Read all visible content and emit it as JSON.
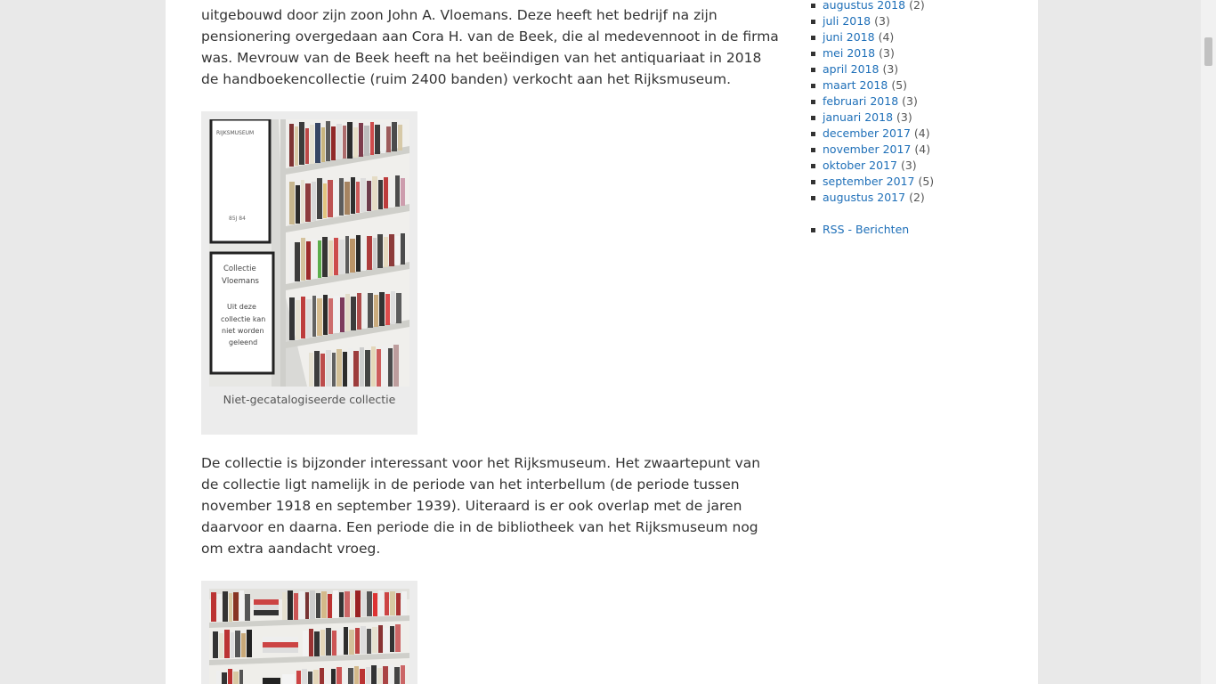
{
  "article": {
    "para1": [
      "uitgebouwd door zijn zoon John A. Vloemans. Deze heeft het bedrijf na zijn",
      "pensionering overgedaan aan Cora H. van de Beek, die al medevennoot in de firma",
      "was. Mevrouw van de Beek heeft na het beëindigen van het antiquariaat in 2018",
      "de handboekencollectie (ruim 2400 banden) verkocht aan het Rijksmuseum."
    ],
    "figure1": {
      "caption": "Niet-gecatalogiseerde collectie",
      "sign_top_title": "RIJKSMUSEUM",
      "sign_top_code": "85J 84",
      "sign_lines": [
        "Collectie",
        "Vloemans",
        "Uit deze",
        "collectie kan",
        "niet worden",
        "geleend"
      ]
    },
    "para2": [
      "De collectie is bijzonder interessant voor het Rijksmuseum. Het zwaartepunt van",
      "de collectie ligt namelijk in de periode van het interbellum (de periode tussen",
      "november 1918 en september 1939). Uiteraard is er ook overlap met de jaren",
      "daarvoor en daarna. Een periode die in de bibliotheek van het Rijksmuseum nog",
      "om extra aandacht vroeg."
    ]
  },
  "sidebar": {
    "archive": [
      {
        "label": "augustus 2018",
        "count": "(2)"
      },
      {
        "label": "juli 2018",
        "count": "(3)"
      },
      {
        "label": "juni 2018",
        "count": "(4)"
      },
      {
        "label": "mei 2018",
        "count": "(3)"
      },
      {
        "label": "april 2018",
        "count": "(3)"
      },
      {
        "label": "maart 2018",
        "count": "(5)"
      },
      {
        "label": "februari 2018",
        "count": "(3)"
      },
      {
        "label": "januari 2018",
        "count": "(3)"
      },
      {
        "label": "december 2017",
        "count": "(4)"
      },
      {
        "label": "november 2017",
        "count": "(4)"
      },
      {
        "label": "oktober 2017",
        "count": "(3)"
      },
      {
        "label": "september 2017",
        "count": "(5)"
      },
      {
        "label": "augustus 2017",
        "count": "(2)"
      }
    ],
    "rss": "RSS - Berichten"
  },
  "colors": {
    "link": "#1e6fb8",
    "text": "#333333",
    "page_bg": "#ffffff",
    "outer_bg": "#e9e9e9"
  }
}
